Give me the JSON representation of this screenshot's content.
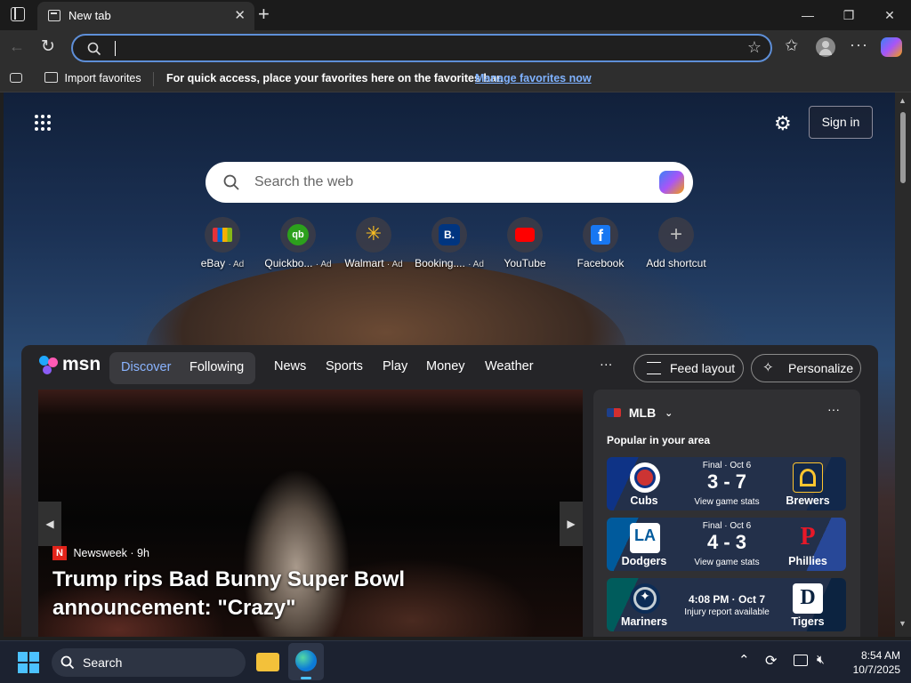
{
  "browser": {
    "tab_title": "New tab",
    "address_value": "",
    "favbar": {
      "import_label": "Import favorites",
      "message": "For quick access, place your favorites here on the favorites bar.",
      "manage_link": "Manage favorites now"
    }
  },
  "newtab": {
    "sign_in": "Sign in",
    "search_placeholder": "Search the web",
    "shortcuts": [
      {
        "label": "eBay",
        "ad": "· Ad",
        "icon": "ebay-icon",
        "color": "#ffffff"
      },
      {
        "label": "Quickbo...",
        "ad": "· Ad",
        "icon": "quickbooks-icon",
        "color": "#2ca01c"
      },
      {
        "label": "Walmart",
        "ad": "· Ad",
        "icon": "walmart-icon",
        "color": "#ffc220"
      },
      {
        "label": "Booking....",
        "ad": "· Ad",
        "icon": "booking-icon",
        "color": "#003580"
      },
      {
        "label": "YouTube",
        "ad": "",
        "icon": "youtube-icon",
        "color": "#ff0000"
      },
      {
        "label": "Facebook",
        "ad": "",
        "icon": "facebook-icon",
        "color": "#1877f2"
      },
      {
        "label": "Add shortcut",
        "ad": "",
        "icon": "plus-icon",
        "color": "#cccccc"
      }
    ]
  },
  "msn": {
    "brand": "msn",
    "tabs": [
      "Discover",
      "Following"
    ],
    "nav": [
      "News",
      "Sports",
      "Play",
      "Money",
      "Weather"
    ],
    "more": "···",
    "feed_layout": "Feed layout",
    "personalize": "Personalize",
    "hero": {
      "source": "Newsweek",
      "age": "· 9h",
      "headline": "Trump rips Bad Bunny Super Bowl announcement: \"Crazy\""
    },
    "sports": {
      "league": "MLB",
      "section": "Popular in your area",
      "games": [
        {
          "status": "Final · Oct 6",
          "score": "3 - 7",
          "sub": "View game stats",
          "home": "Cubs",
          "away": "Brewers",
          "c1": "#0e3386",
          "c2": "#12284b"
        },
        {
          "status": "Final · Oct 6",
          "score": "4 - 3",
          "sub": "View game stats",
          "home": "Dodgers",
          "away": "Phillies",
          "c1": "#005a9c",
          "c2": "#284898"
        },
        {
          "status": "4:08 PM · Oct 7",
          "score": "",
          "sub": "Injury report available",
          "home": "Mariners",
          "away": "Tigers",
          "c1": "#0c2c56",
          "c2": "#0c2340"
        }
      ]
    }
  },
  "taskbar": {
    "search_label": "Search",
    "time": "8:54 AM",
    "date": "10/7/2025"
  }
}
